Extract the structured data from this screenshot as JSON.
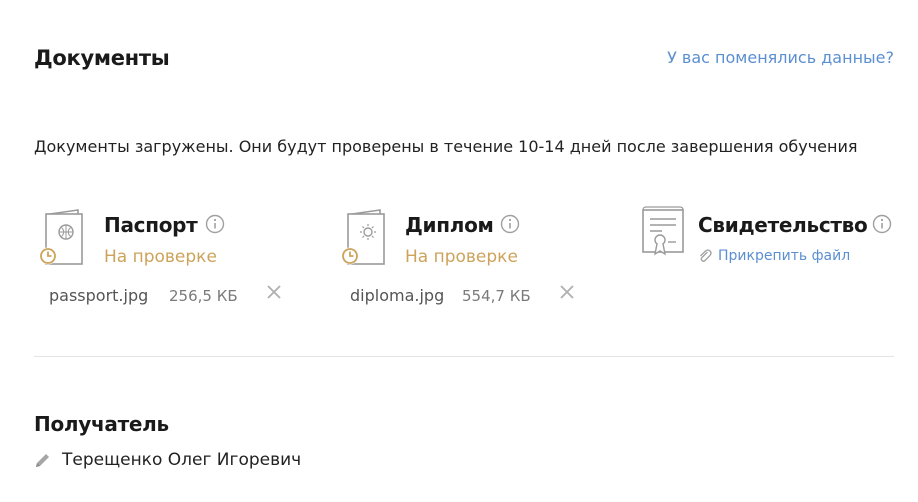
{
  "documents": {
    "title": "Документы",
    "changed_data_link": "У вас поменялись данные?",
    "notice": "Документы загружены. Они будут проверены в течение 10-14 дней после завершения обучения",
    "items": [
      {
        "name": "Паспорт",
        "status": "На проверке",
        "icon": "passport-icon",
        "file_name": "passport.jpg",
        "file_size": "256,5 КБ"
      },
      {
        "name": "Диплом",
        "status": "На проверке",
        "icon": "diploma-icon",
        "file_name": "diploma.jpg",
        "file_size": "554,7 КБ"
      },
      {
        "name": "Свидетельство",
        "icon": "certificate-icon",
        "attach_label": "Прикрепить файл"
      }
    ],
    "colors": {
      "status": "#cda35b",
      "link": "#5b8fd1"
    }
  },
  "recipient": {
    "title": "Получатель",
    "name": "Терещенко Олег Игоревич",
    "edit_icon": "pencil-icon"
  }
}
